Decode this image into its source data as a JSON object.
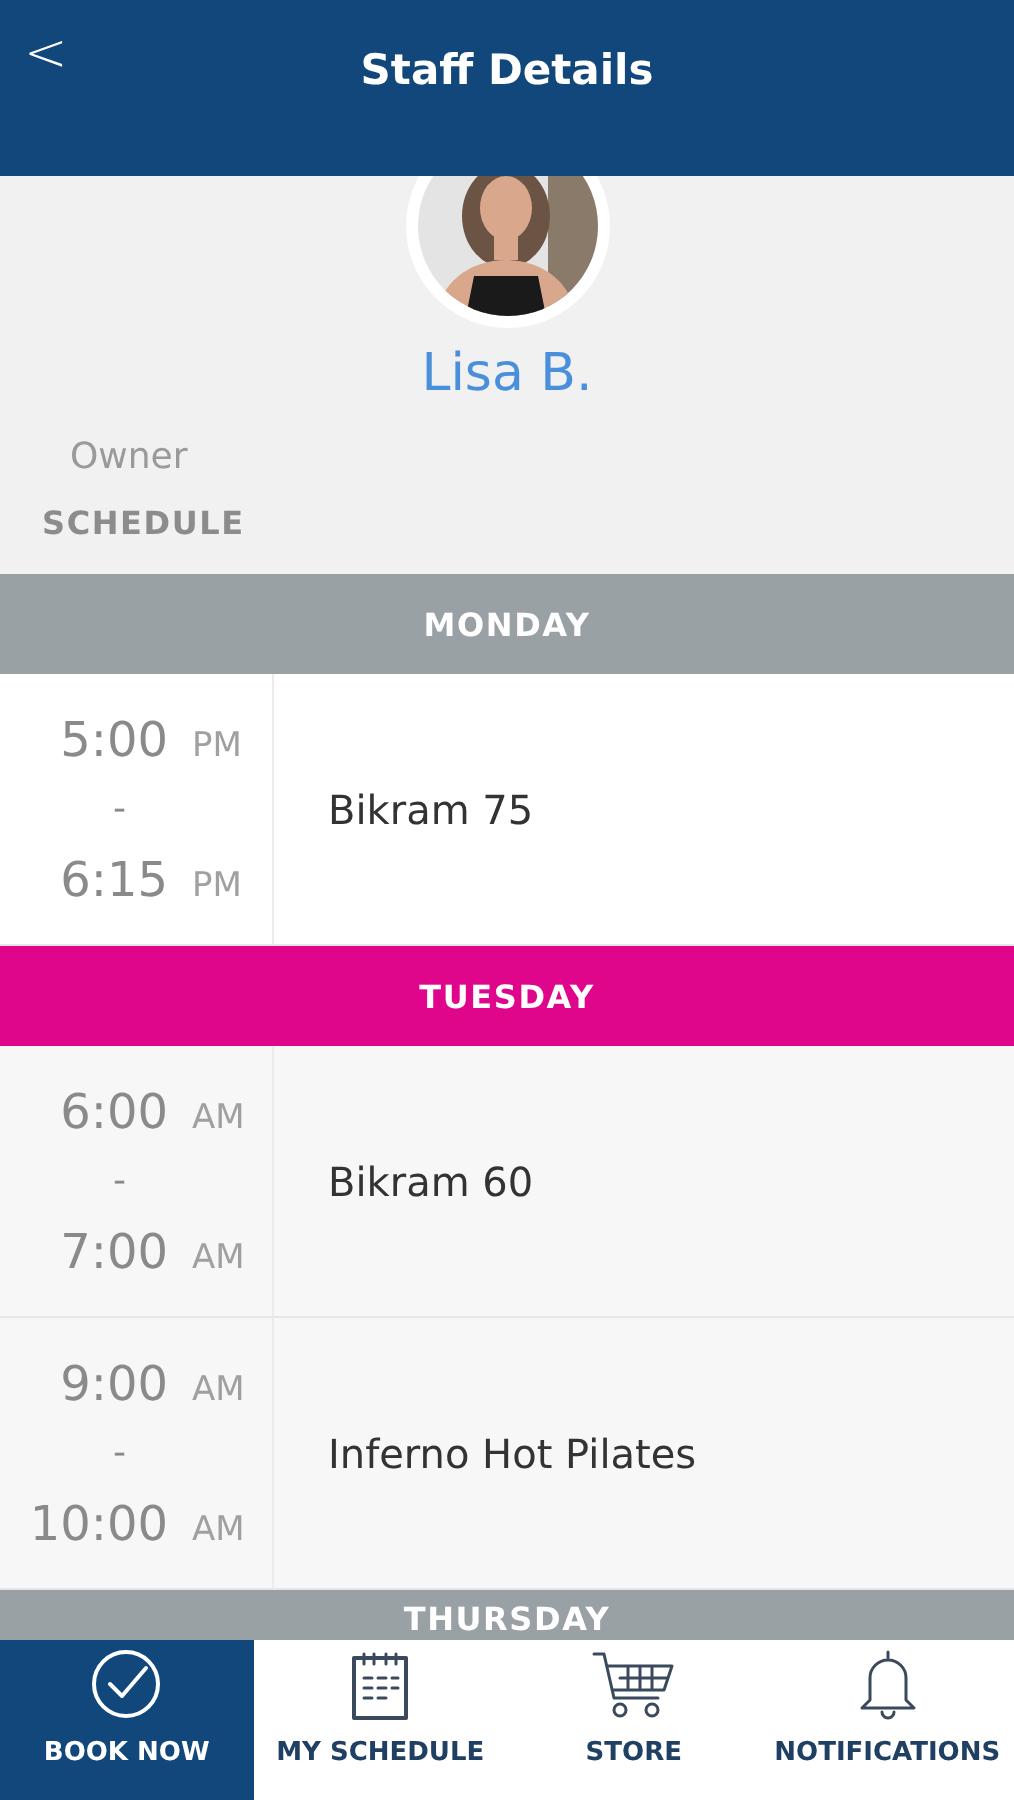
{
  "header": {
    "back": "<",
    "title": "Staff Details"
  },
  "profile": {
    "name": "Lisa B.",
    "role": "Owner",
    "section": "SCHEDULE"
  },
  "days": [
    {
      "label": "MONDAY",
      "color": "#9aa1a4",
      "classes": [
        {
          "start": "5:00",
          "start_period": "PM",
          "separator": "-",
          "end": "6:15",
          "end_period": "PM",
          "name": "Bikram 75"
        }
      ]
    },
    {
      "label": "TUESDAY",
      "color": "#e0068c",
      "classes": [
        {
          "start": "6:00",
          "start_period": "AM",
          "separator": "-",
          "end": "7:00",
          "end_period": "AM",
          "name": "Bikram 60"
        },
        {
          "start": "9:00",
          "start_period": "AM",
          "separator": "-",
          "end": "10:00",
          "end_period": "AM",
          "name": "Inferno Hot Pilates"
        }
      ]
    },
    {
      "label": "THURSDAY",
      "color": "#9aa1a4"
    }
  ],
  "nav": [
    {
      "label": "BOOK NOW",
      "selected": true
    },
    {
      "label": "MY SCHEDULE",
      "selected": false
    },
    {
      "label": "STORE",
      "selected": false
    },
    {
      "label": "NOTIFICATIONS",
      "selected": false
    }
  ]
}
